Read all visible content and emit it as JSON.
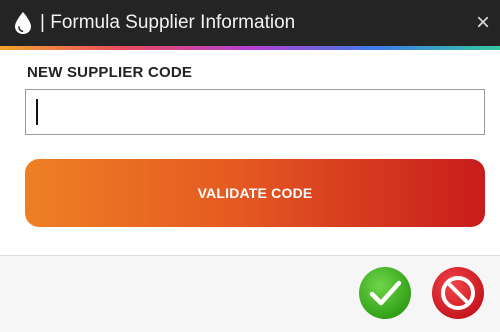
{
  "window": {
    "title": "| Formula Supplier Information",
    "close_glyph": "×",
    "app_icon": "water-drop-icon",
    "titlebar_color": "#242424"
  },
  "form": {
    "supplier_code_label": "NEW SUPPLIER CODE",
    "supplier_code_value": "",
    "validate_button_label": "VALIDATE CODE"
  },
  "footer": {
    "confirm_icon": "checkmark-icon",
    "cancel_icon": "prohibited-icon",
    "confirm_color": "#3cae1c",
    "cancel_color": "#e01f26"
  },
  "colors": {
    "validate_gradient_start": "#ee7f24",
    "validate_gradient_end": "#c81c1c"
  }
}
